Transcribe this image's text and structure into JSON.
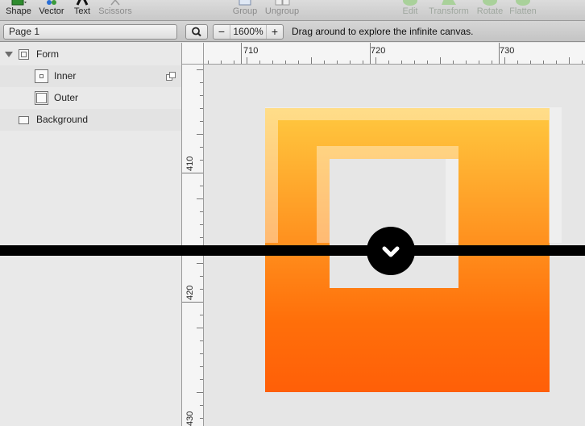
{
  "toolbar": {
    "tools": [
      {
        "id": "shape",
        "label": "Shape",
        "icon": "shape-icon"
      },
      {
        "id": "vector",
        "label": "Vector",
        "icon": "vector-icon"
      },
      {
        "id": "text",
        "label": "Text",
        "icon": "text-icon"
      },
      {
        "id": "scissors",
        "label": "Scissors",
        "icon": "scissors-icon"
      },
      {
        "id": "group",
        "label": "Group",
        "icon": "group-icon"
      },
      {
        "id": "ungroup",
        "label": "Ungroup",
        "icon": "ungroup-icon"
      },
      {
        "id": "edit",
        "label": "Edit",
        "icon": "edit-icon"
      },
      {
        "id": "transform",
        "label": "Transform",
        "icon": "transform-icon"
      },
      {
        "id": "rotate",
        "label": "Rotate",
        "icon": "rotate-icon"
      },
      {
        "id": "flatten",
        "label": "Flatten",
        "icon": "flatten-icon"
      }
    ]
  },
  "bar": {
    "page": "Page 1",
    "zoom": "1600%",
    "zoom_minus": "−",
    "zoom_plus": "+",
    "hint": "Drag around to explore the infinite canvas."
  },
  "layers": [
    {
      "name": "Form",
      "type": "group",
      "expanded": true
    },
    {
      "name": "Inner",
      "type": "shape"
    },
    {
      "name": "Outer",
      "type": "shape"
    },
    {
      "name": "Background",
      "type": "rectangle"
    }
  ],
  "rulers": {
    "horizontal": [
      "710",
      "720",
      "730"
    ],
    "vertical": [
      "410",
      "420",
      "430"
    ]
  },
  "colors": {
    "gradient_top": "#ffc940",
    "gradient_bottom": "#ff5f08",
    "canvas": "#e6e6e6",
    "overlay": "#000000"
  }
}
